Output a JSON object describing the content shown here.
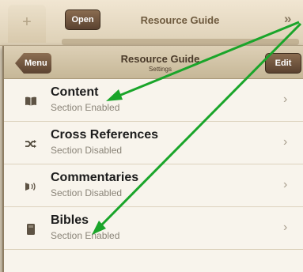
{
  "background_bar": {
    "plus_label": "+",
    "open_label": "Open",
    "title": "Resource Guide",
    "chevrons": "»"
  },
  "panel": {
    "menu_label": "Menu",
    "title": "Resource Guide",
    "subtitle": "Settings",
    "edit_label": "Edit"
  },
  "sections": [
    {
      "title": "Content",
      "status": "Section Enabled",
      "icon": "book-icon"
    },
    {
      "title": "Cross References",
      "status": "Section Disabled",
      "icon": "shuffle-icon"
    },
    {
      "title": "Commentaries",
      "status": "Section Disabled",
      "icon": "speaker-icon"
    },
    {
      "title": "Bibles",
      "status": "Section Enabled",
      "icon": "bible-icon"
    }
  ],
  "colors": {
    "annotation_arrow": "#1aa52a",
    "button_brown": "#6e5440"
  }
}
